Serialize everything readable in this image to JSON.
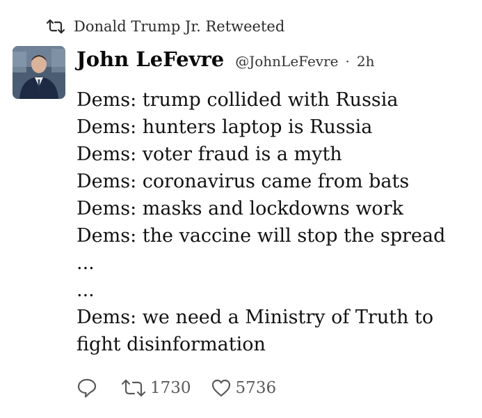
{
  "retweet_banner": {
    "icon": "retweet-icon",
    "text": "Donald Trump Jr. Retweeted"
  },
  "author": {
    "avatar": "avatar-photo",
    "display_name": "John LeFevre",
    "handle": "@JohnLeFevre",
    "separator": "·",
    "time": "2h"
  },
  "tweet": {
    "lines": [
      "Dems: trump collided with Russia",
      "Dems: hunters laptop is Russia",
      "Dems: voter fraud is a myth",
      "Dems: coronavirus came from bats",
      "Dems: masks and lockdowns work",
      "Dems: the vaccine will stop the spread",
      "...",
      "...",
      "Dems: we need a Ministry of Truth to fight disinformation"
    ]
  },
  "actions": {
    "reply": {
      "icon": "reply-icon"
    },
    "retweet": {
      "icon": "retweet-icon",
      "count": "1730"
    },
    "like": {
      "icon": "heart-icon",
      "count": "5736"
    }
  },
  "colors": {
    "text": "#111111",
    "muted": "#5a5a5a",
    "background": "#ffffff"
  }
}
